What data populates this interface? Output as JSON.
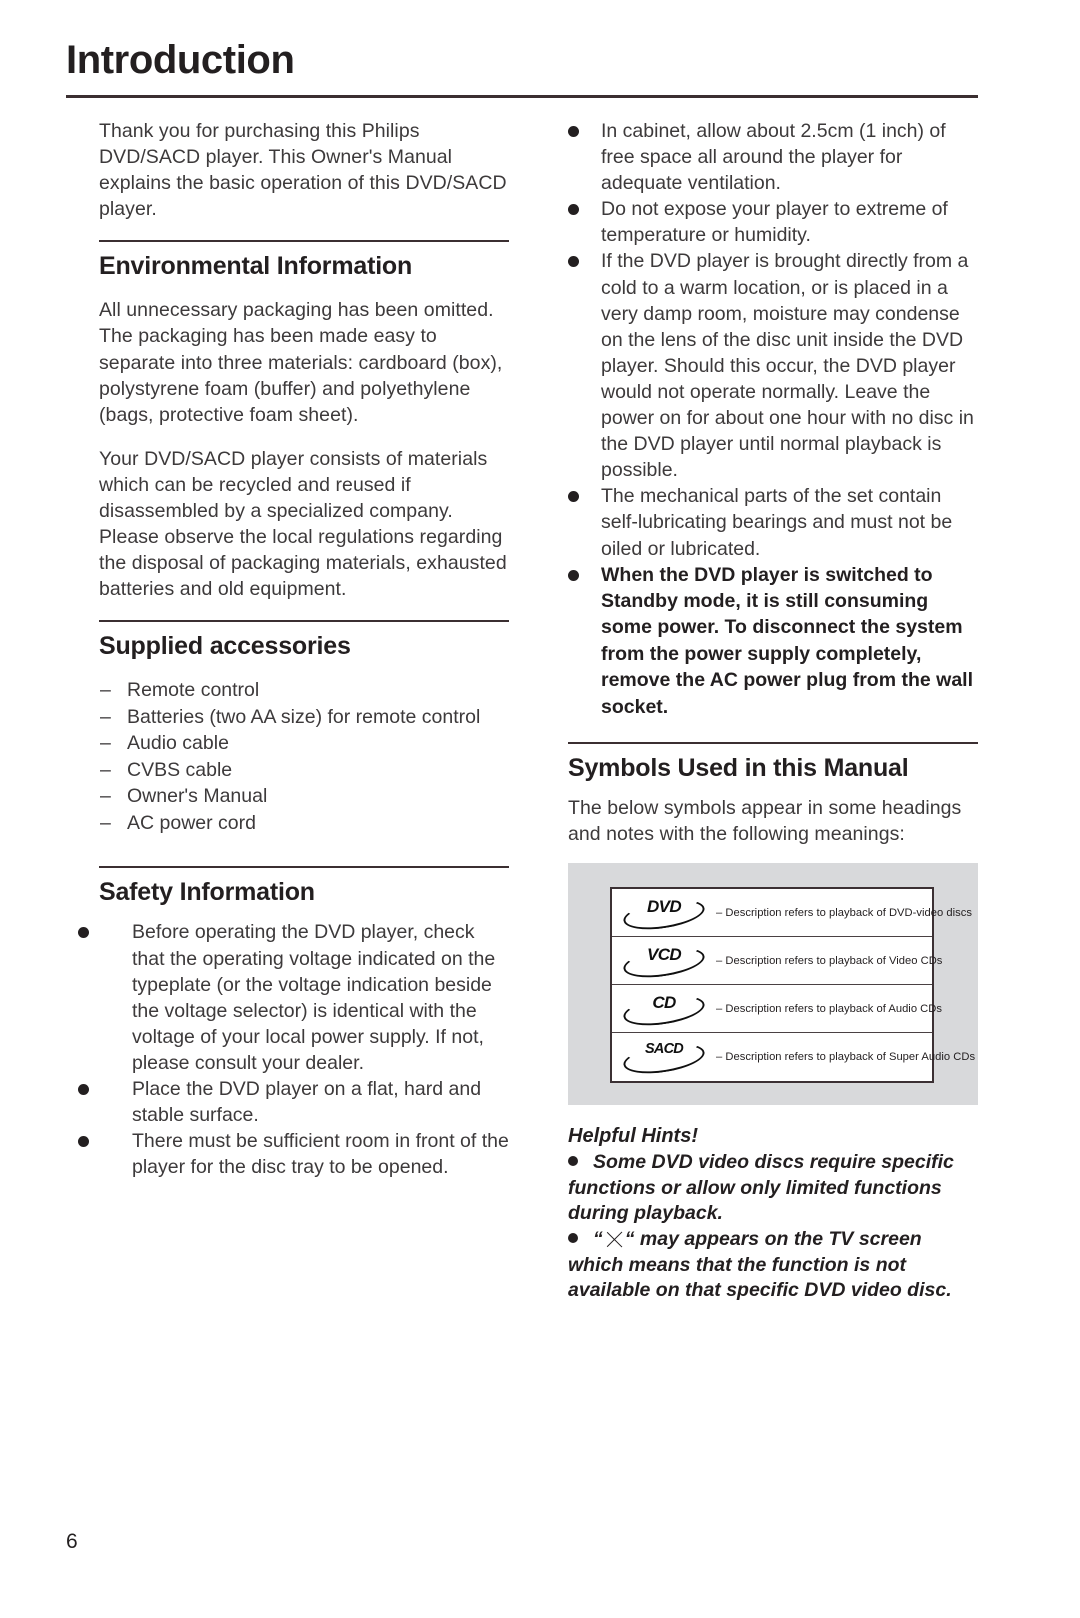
{
  "header": {
    "title": "Introduction"
  },
  "left_column": {
    "intro_paragraph": "Thank you for purchasing this Philips DVD/SACD player. This Owner's Manual explains the basic operation of this DVD/SACD player.",
    "environmental": {
      "heading": "Environmental Information",
      "paragraph_1": "All unnecessary packaging has been omitted. The packaging has been made easy to separate into three materials: cardboard (box), polystyrene foam (buffer) and polyethylene (bags, protective foam sheet).",
      "paragraph_2": "Your DVD/SACD player consists of materials which can be recycled and reused if disassembled by a specialized company. Please observe the local regulations regarding the disposal of packaging materials, exhausted batteries and old equipment."
    },
    "supplied_accessories": {
      "heading": "Supplied accessories",
      "dash": "–",
      "items": [
        "Remote control",
        "Batteries (two AA size) for remote control",
        "Audio cable",
        "CVBS cable",
        "Owner's Manual",
        "AC power cord"
      ]
    },
    "safety_information": {
      "heading": "Safety Information",
      "bullets": [
        "Before operating the DVD player, check that the operating voltage indicated on the typeplate (or the voltage indication beside the voltage selector) is identical with the voltage of your local power supply. If not, please consult your dealer.",
        "Place the DVD player on a flat, hard and stable surface.",
        "There must be sufficient room in front of the player for the disc tray to be opened."
      ]
    }
  },
  "right_column": {
    "safety_bullets": [
      {
        "text": "In cabinet, allow about 2.5cm (1 inch) of free space all around the player for adequate ventilation.",
        "bold": false
      },
      {
        "text": "Do not expose your player to extreme of temperature or humidity.",
        "bold": false
      },
      {
        "text": "If the DVD player is brought directly from a cold to a warm location, or is placed in a very damp room, moisture may condense on the lens of the disc unit inside the DVD player. Should this occur, the DVD player would not operate normally. Leave the power on for about one hour with no disc in the DVD player until normal playback is possible.",
        "bold": false
      },
      {
        "text": "The mechanical parts of the set contain self-lubricating bearings and must not be oiled or lubricated.",
        "bold": false
      },
      {
        "text": "When the DVD player is switched to Standby mode, it is still consuming some power. To disconnect the system from the power supply completely, remove the AC power plug from the wall socket.",
        "bold": true
      }
    ],
    "symbols_section": {
      "heading": "Symbols Used in this Manual",
      "intro": "The below symbols appear in some headings and notes with the following meanings:",
      "rows": [
        {
          "logo": "DVD",
          "description": "– Description refers to playback of DVD-video discs"
        },
        {
          "logo": "VCD",
          "description": "– Description refers to playback of Video CDs"
        },
        {
          "logo": "CD",
          "description": "– Description refers to playback of Audio CDs"
        },
        {
          "logo": "SACD",
          "description": "– Description refers to playback of Super Audio CDs"
        }
      ]
    },
    "helpful_hints": {
      "title": "Helpful Hints!",
      "hint_1": "Some DVD video discs require specific functions or allow only limited functions during playback.",
      "hint_2_prefix": "“",
      "hint_2_suffix": "“ may appears on the TV screen which means that the function is not available on that specific DVD video disc."
    }
  },
  "footer": {
    "page_number": "6"
  },
  "colors": {
    "text": "#3d3a3b",
    "heading": "#231f20",
    "rule": "#3b2f31",
    "symbols_background": "#d8d9db"
  }
}
